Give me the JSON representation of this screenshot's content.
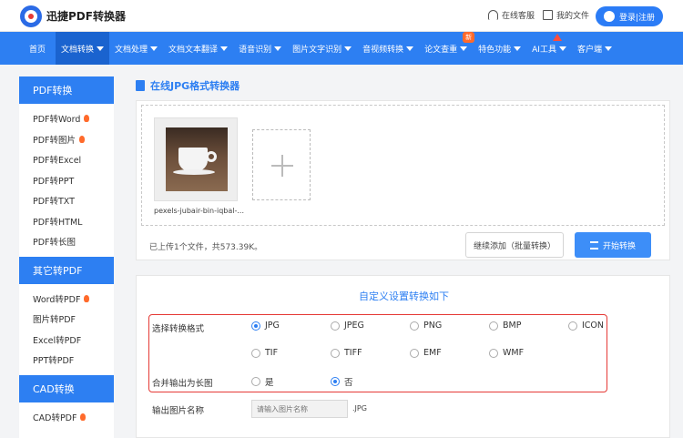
{
  "header": {
    "brand": "迅捷PDF转换器",
    "support": "在线客服",
    "my_files": "我的文件",
    "login": "登录|注册"
  },
  "nav": {
    "items": [
      {
        "label": "首页",
        "active": false,
        "caret": false
      },
      {
        "label": "文档转换",
        "active": true,
        "caret": true
      },
      {
        "label": "文档处理",
        "active": false,
        "caret": true
      },
      {
        "label": "文档文本翻译",
        "active": false,
        "caret": true
      },
      {
        "label": "语音识别",
        "active": false,
        "caret": true
      },
      {
        "label": "图片文字识别",
        "active": false,
        "caret": true
      },
      {
        "label": "音视频转换",
        "active": false,
        "caret": true
      },
      {
        "label": "论文查重",
        "active": false,
        "caret": true,
        "badge": "新"
      },
      {
        "label": "特色功能",
        "active": false,
        "caret": true
      },
      {
        "label": "AI工具",
        "active": false,
        "caret": true,
        "dot": true
      },
      {
        "label": "客户端",
        "active": false,
        "caret": true
      }
    ]
  },
  "sidebar": {
    "sections": [
      {
        "title": "PDF转换",
        "items": [
          {
            "label": "PDF转Word",
            "hot": true
          },
          {
            "label": "PDF转图片",
            "hot": true
          },
          {
            "label": "PDF转Excel",
            "hot": false
          },
          {
            "label": "PDF转PPT",
            "hot": false
          },
          {
            "label": "PDF转TXT",
            "hot": false
          },
          {
            "label": "PDF转HTML",
            "hot": false
          },
          {
            "label": "PDF转长图",
            "hot": false
          }
        ]
      },
      {
        "title": "其它转PDF",
        "items": [
          {
            "label": "Word转PDF",
            "hot": true
          },
          {
            "label": "图片转PDF",
            "hot": false
          },
          {
            "label": "Excel转PDF",
            "hot": false
          },
          {
            "label": "PPT转PDF",
            "hot": false
          }
        ]
      },
      {
        "title": "CAD转换",
        "items": [
          {
            "label": "CAD转PDF",
            "hot": true
          }
        ]
      }
    ]
  },
  "main": {
    "title": "在线JPG格式转换器",
    "file_name": "pexels-jubair-bin-iqbal-...",
    "status": "已上传1个文件，共573.39K。",
    "continue_button": "继续添加（批量转换）",
    "start_button": "开始转换"
  },
  "settings": {
    "title": "自定义设置转换如下",
    "format_label": "选择转换格式",
    "formats": [
      "JPG",
      "JPEG",
      "PNG",
      "BMP",
      "ICON",
      "TIF",
      "TIFF",
      "EMF",
      "WMF"
    ],
    "selected_format": "JPG",
    "merge_label": "合并输出为长图",
    "merge_options": [
      "是",
      "否"
    ],
    "merge_selected": "否",
    "output_label": "输出图片名称",
    "output_placeholder": "请输入图片名称",
    "output_ext": ".JPG"
  },
  "colors": {
    "primary": "#2d7ff2",
    "highlight_border": "#e53935",
    "hot": "#ff6a2b"
  }
}
